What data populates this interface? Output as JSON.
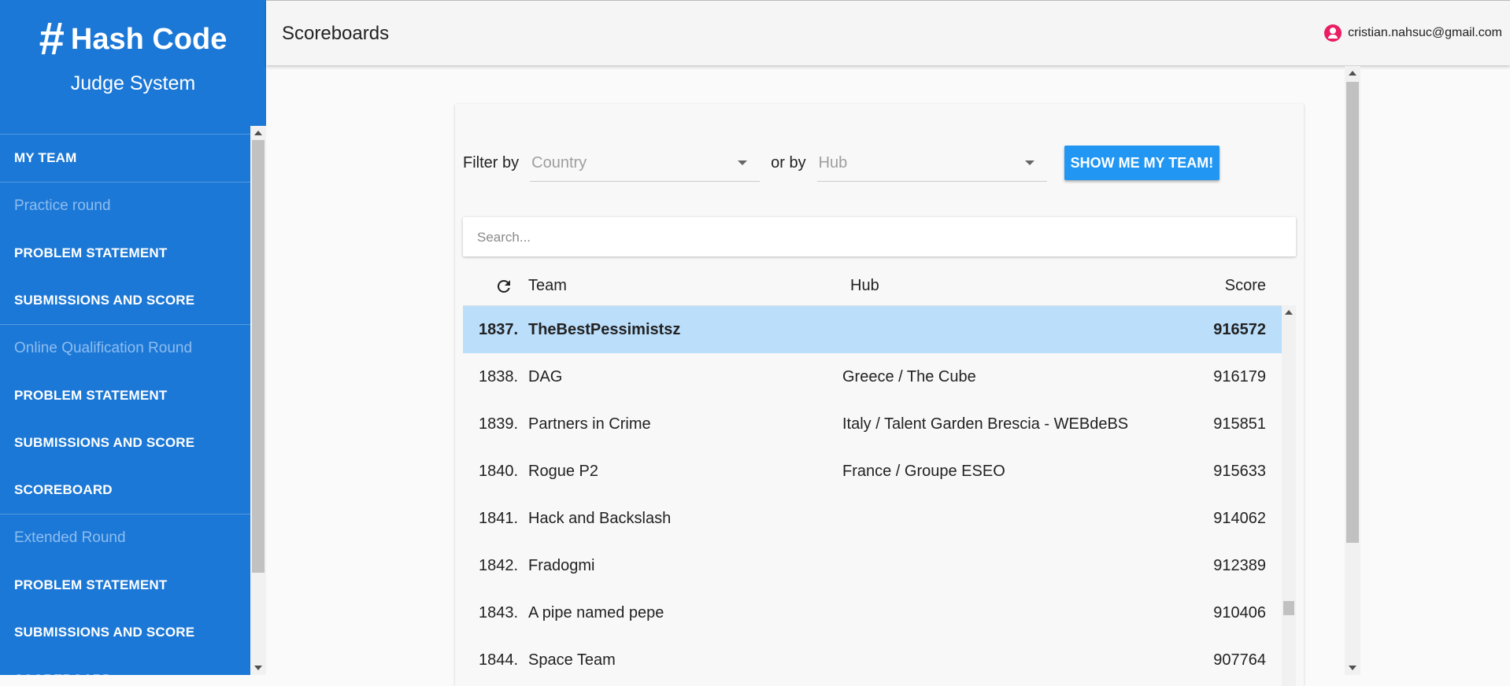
{
  "sidebar": {
    "logo_hash": "#",
    "logo_text": "Hash Code",
    "subtitle": "Judge System",
    "my_team": "MY TEAM",
    "sections": [
      {
        "title": "Practice round",
        "items": [
          "PROBLEM STATEMENT",
          "SUBMISSIONS AND SCORE"
        ]
      },
      {
        "title": "Online Qualification Round",
        "items": [
          "PROBLEM STATEMENT",
          "SUBMISSIONS AND SCORE",
          "SCOREBOARD"
        ]
      },
      {
        "title": "Extended Round",
        "items": [
          "PROBLEM STATEMENT",
          "SUBMISSIONS AND SCORE",
          "SCOREBOARD"
        ]
      }
    ]
  },
  "header": {
    "title": "Scoreboards",
    "user_email": "cristian.nahsuc@gmail.com"
  },
  "filters": {
    "filter_by_label": "Filter by",
    "country_placeholder": "Country",
    "or_by_label": "or by",
    "hub_placeholder": "Hub",
    "show_team_button": "SHOW ME MY TEAM!"
  },
  "search": {
    "placeholder": "Search..."
  },
  "table": {
    "columns": {
      "team": "Team",
      "hub": "Hub",
      "score": "Score"
    },
    "rows": [
      {
        "rank": "1837.",
        "team": "TheBestPessimistsz",
        "hub": "",
        "score": "916572",
        "highlight": true
      },
      {
        "rank": "1838.",
        "team": "DAG",
        "hub": "Greece / The Cube",
        "score": "916179"
      },
      {
        "rank": "1839.",
        "team": "Partners in Crime",
        "hub": "Italy / Talent Garden Brescia - WEBdeBS",
        "score": "915851"
      },
      {
        "rank": "1840.",
        "team": "Rogue P2",
        "hub": "France / Groupe ESEO",
        "score": "915633"
      },
      {
        "rank": "1841.",
        "team": "Hack and Backslash",
        "hub": "",
        "score": "914062"
      },
      {
        "rank": "1842.",
        "team": "Fradogmi",
        "hub": "",
        "score": "912389"
      },
      {
        "rank": "1843.",
        "team": "A pipe named pepe",
        "hub": "",
        "score": "910406"
      },
      {
        "rank": "1844.",
        "team": "Space Team",
        "hub": "",
        "score": "907764"
      }
    ]
  },
  "colors": {
    "sidebar_bg": "#1c78d6",
    "highlight_row": "#bbdefb",
    "button_bg": "#2196f3",
    "avatar": "#e91e63"
  }
}
